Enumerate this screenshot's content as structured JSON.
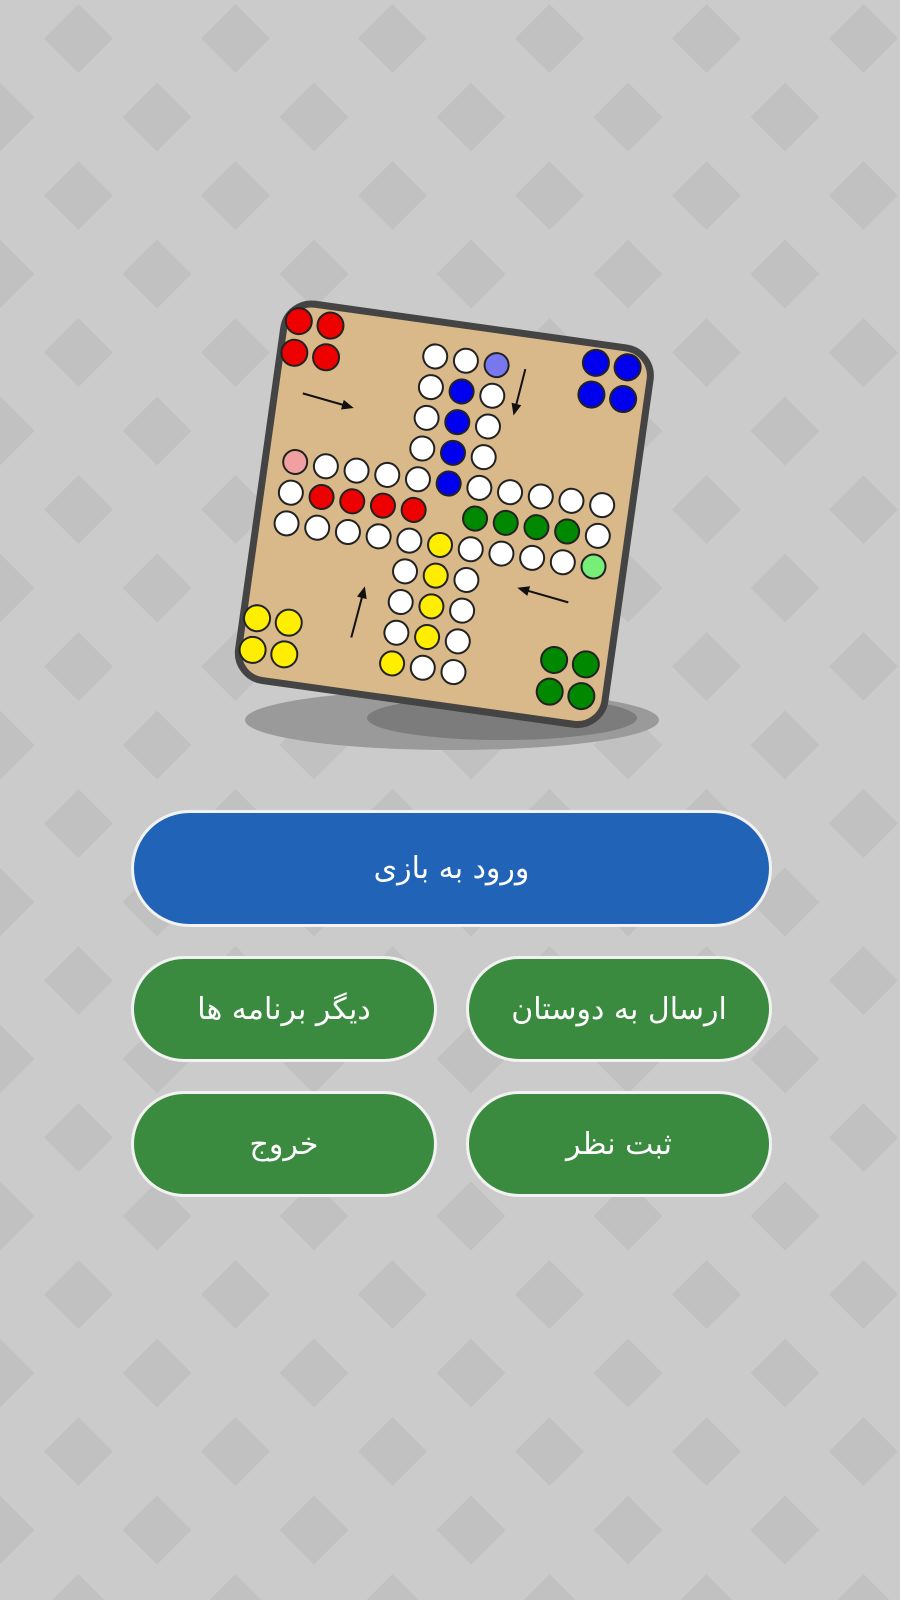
{
  "colors": {
    "background": "#cbcbcb",
    "background_pattern": "#c1c1c1",
    "board_fill": "#d9b98a",
    "board_border": "#444444",
    "primary_button": "#2163b6",
    "secondary_button": "#3a8b3f",
    "button_text": "#ffffff",
    "red": "#ee0000",
    "blue": "#0000ee",
    "green": "#008800",
    "yellow": "#ffee00"
  },
  "board": {
    "icon": "ludo-board-icon",
    "pieces": {
      "red": 4,
      "blue": 4,
      "green": 4,
      "yellow": 4
    }
  },
  "menu": {
    "enter_game_label": "ورود به بازی",
    "share_label": "ارسال به دوستان",
    "other_apps_label": "دیگر برنامه ها",
    "rate_label": "ثبت نظر",
    "exit_label": "خروج"
  }
}
